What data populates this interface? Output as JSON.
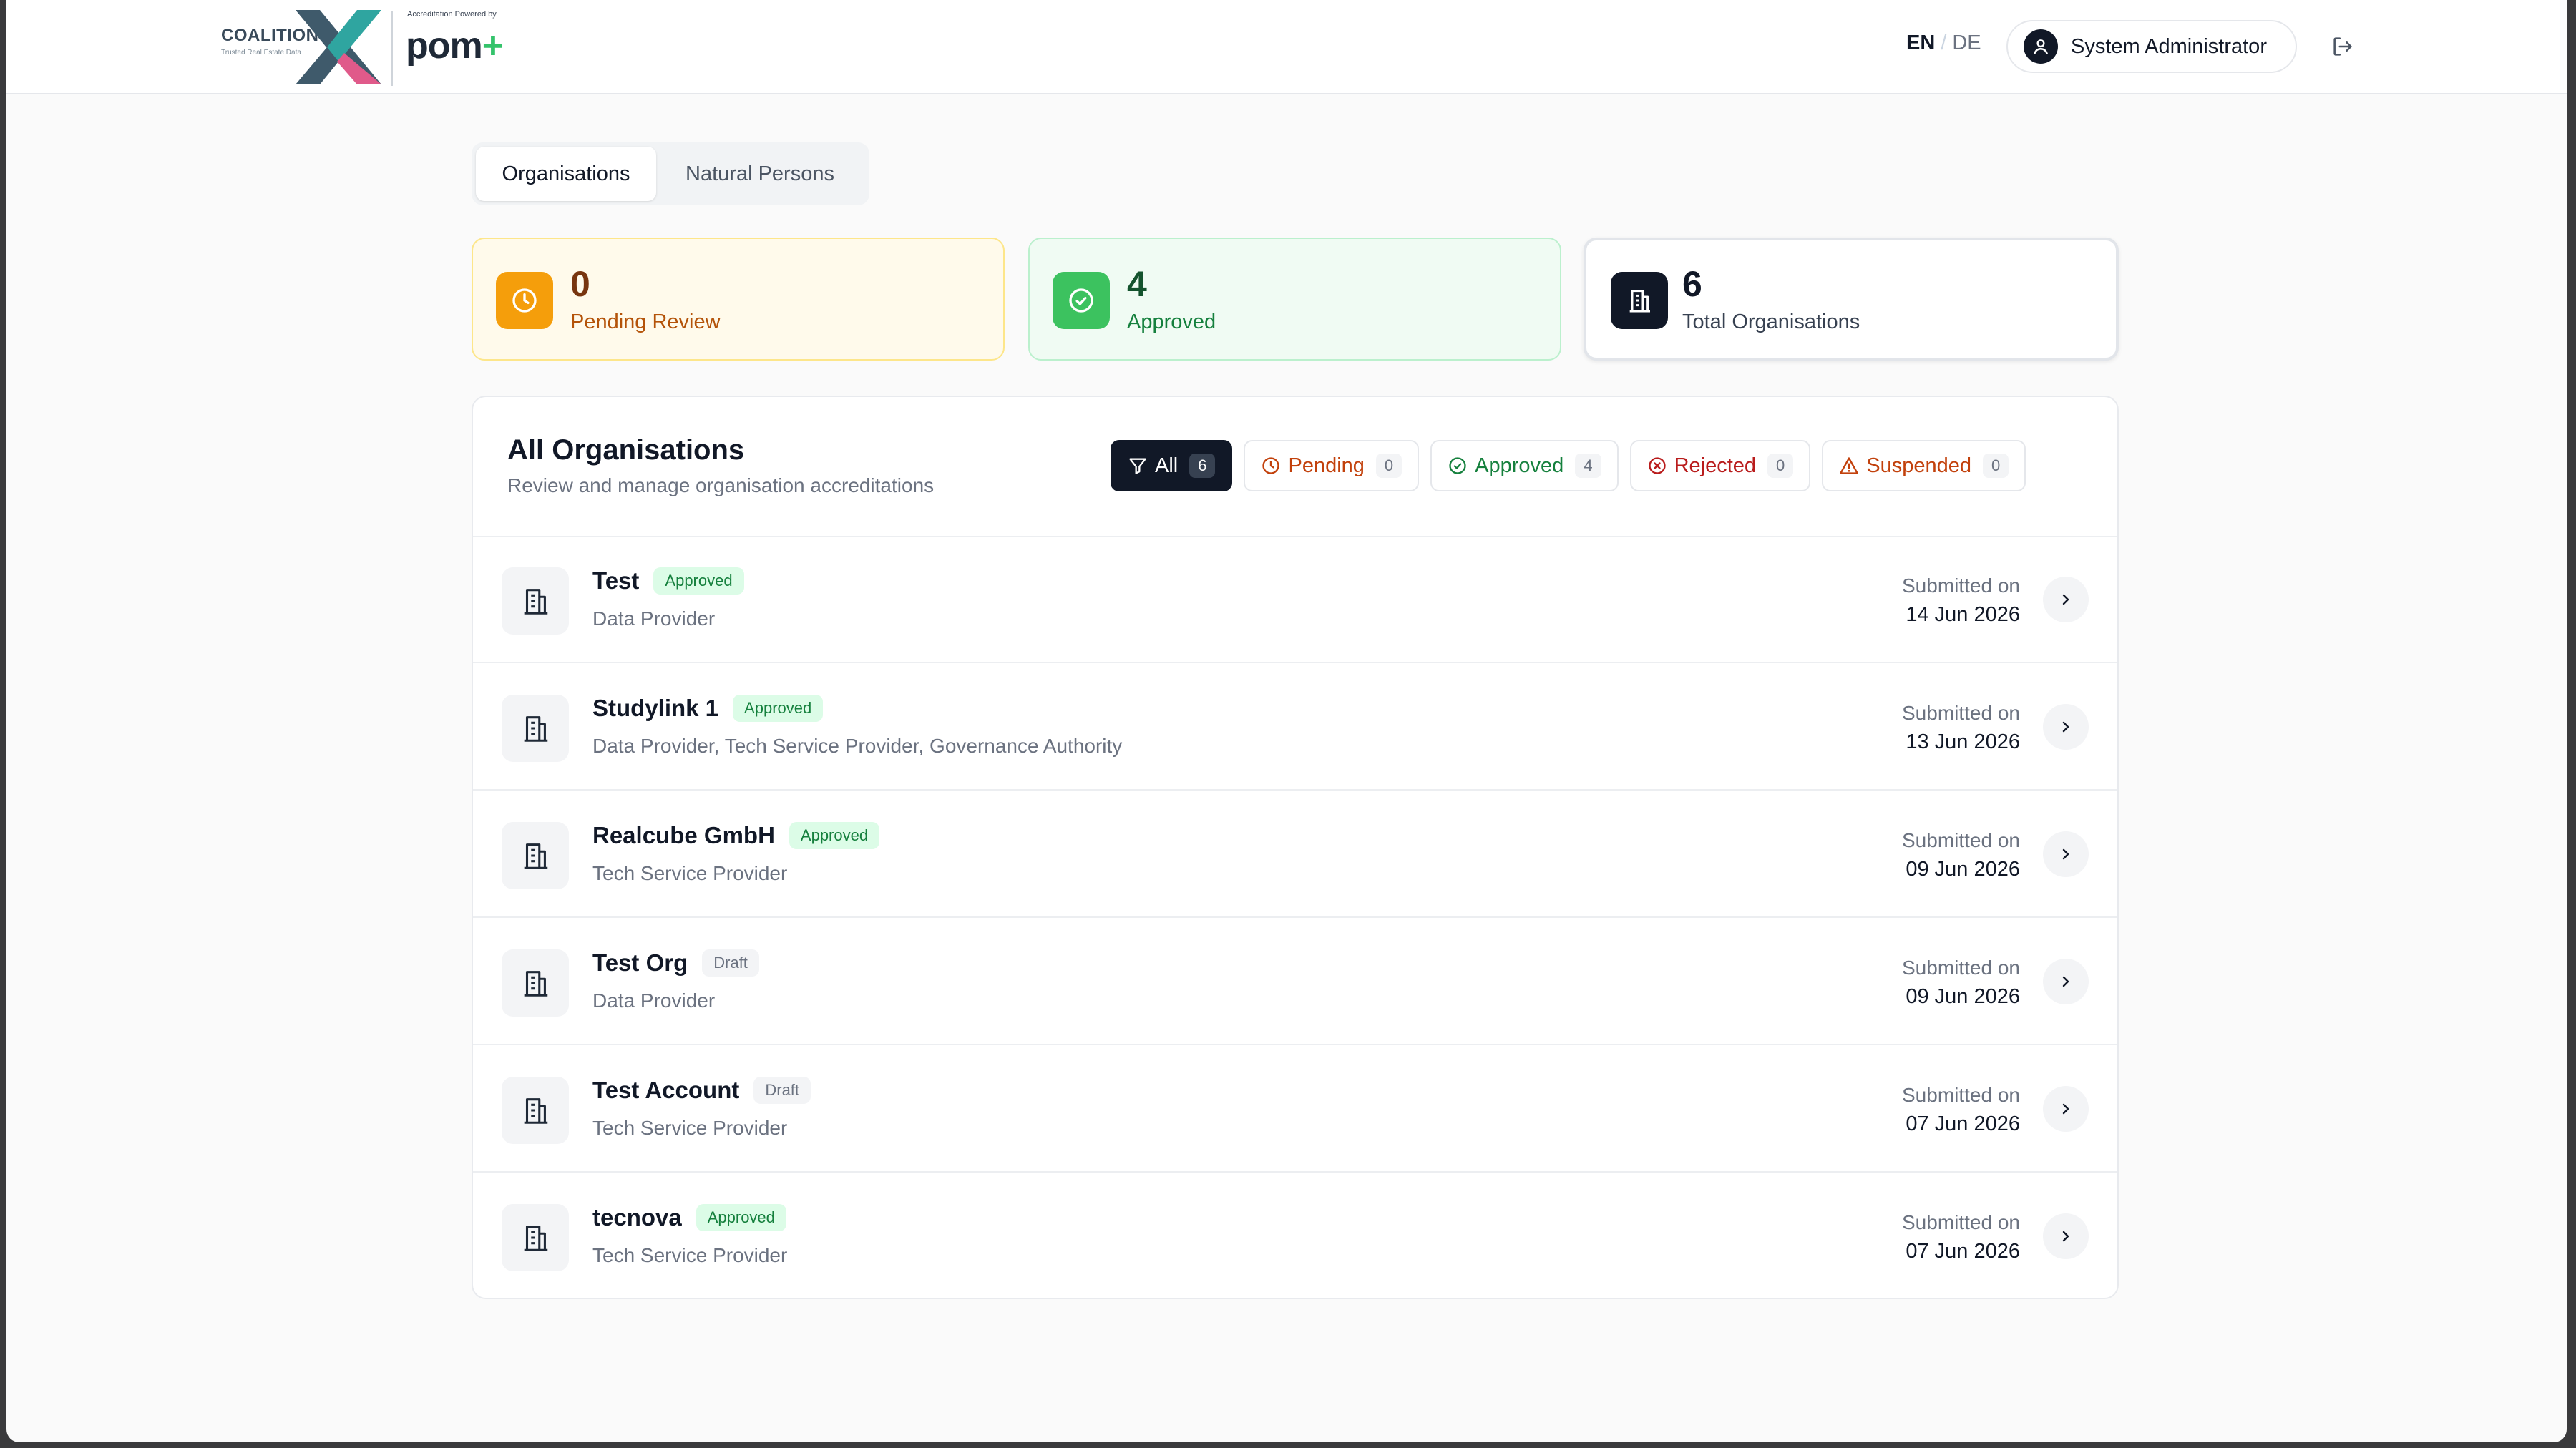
{
  "header": {
    "logo": {
      "brand": "COALITION",
      "tagline": "Trusted Real Estate Data",
      "powered_by": "Accreditation Powered by",
      "product": "pom",
      "product_plus": "+"
    },
    "lang": {
      "active": "EN",
      "separator": "/",
      "other": "DE"
    },
    "user_name": "System Administrator",
    "icons": {
      "user": "user-icon",
      "logout": "logout-icon"
    }
  },
  "tabs": [
    {
      "label": "Organisations",
      "active": true
    },
    {
      "label": "Natural Persons",
      "active": false
    }
  ],
  "stats": {
    "pending": {
      "value": "0",
      "label": "Pending Review",
      "icon": "clock-icon"
    },
    "approved": {
      "value": "4",
      "label": "Approved",
      "icon": "check-circle-icon"
    },
    "total": {
      "value": "6",
      "label": "Total Organisations",
      "icon": "building-icon"
    }
  },
  "panel": {
    "title": "All Organisations",
    "subtitle": "Review and manage organisation accreditations",
    "filters": [
      {
        "key": "all",
        "label": "All",
        "count": "6",
        "icon": "filter-icon"
      },
      {
        "key": "pending",
        "label": "Pending",
        "count": "0",
        "icon": "clock-icon"
      },
      {
        "key": "approved",
        "label": "Approved",
        "count": "4",
        "icon": "check-circle-icon"
      },
      {
        "key": "rejected",
        "label": "Rejected",
        "count": "0",
        "icon": "x-circle-icon"
      },
      {
        "key": "suspended",
        "label": "Suspended",
        "count": "0",
        "icon": "alert-triangle-icon"
      }
    ]
  },
  "rows": [
    {
      "name": "Test",
      "status": "Approved",
      "roles": "Data Provider",
      "submitted_label": "Submitted on",
      "date": "14 Jun 2026"
    },
    {
      "name": "Studylink 1",
      "status": "Approved",
      "roles": "Data Provider, Tech Service Provider, Governance Authority",
      "submitted_label": "Submitted on",
      "date": "13 Jun 2026"
    },
    {
      "name": "Realcube GmbH",
      "status": "Approved",
      "roles": "Tech Service Provider",
      "submitted_label": "Submitted on",
      "date": "09 Jun 2026"
    },
    {
      "name": "Test Org",
      "status": "Draft",
      "roles": "Data Provider",
      "submitted_label": "Submitted on",
      "date": "09 Jun 2026"
    },
    {
      "name": "Test Account",
      "status": "Draft",
      "roles": "Tech Service Provider",
      "submitted_label": "Submitted on",
      "date": "07 Jun 2026"
    },
    {
      "name": "tecnova",
      "status": "Approved",
      "roles": "Tech Service Provider",
      "submitted_label": "Submitted on",
      "date": "07 Jun 2026"
    }
  ],
  "colors": {
    "pending_accent": "#f59e0b",
    "approved_accent": "#3cc25f",
    "dark": "#111827",
    "plus_green": "#34c36b"
  }
}
